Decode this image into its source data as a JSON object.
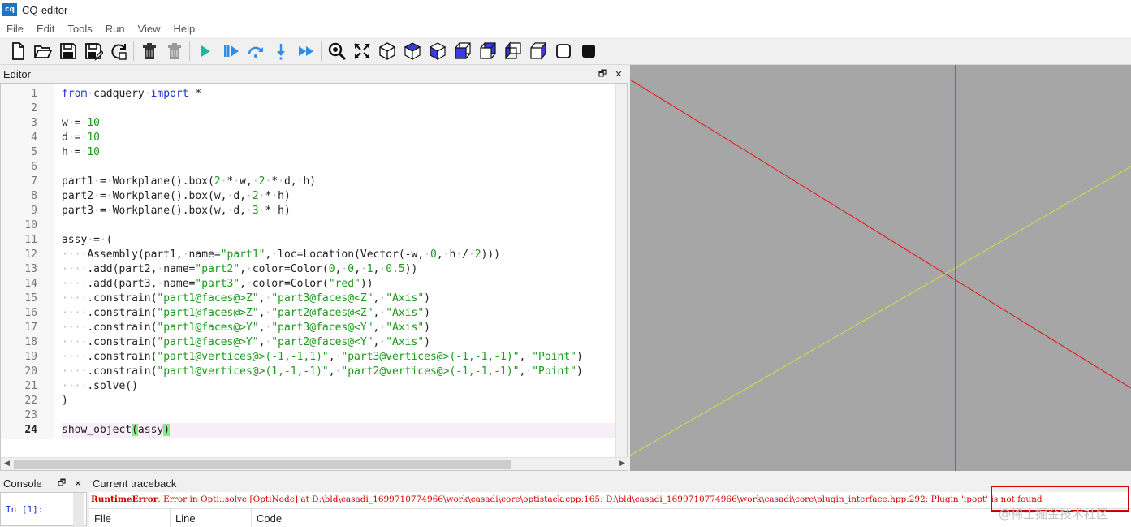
{
  "app": {
    "icon_text": "cq",
    "title": "CQ-editor"
  },
  "menu": [
    "File",
    "Edit",
    "Tools",
    "Run",
    "View",
    "Help"
  ],
  "toolbar": {
    "icons": [
      "new-file-icon",
      "open-file-icon",
      "save-icon",
      "save-as-icon",
      "reload-icon",
      "clear-icon",
      "delete-icon",
      "run-icon",
      "debug-icon",
      "step-over-icon",
      "step-into-icon",
      "continue-icon",
      "zoom-icon",
      "fit-icon",
      "iso-view-icon",
      "top-view-icon",
      "bottom-view-icon",
      "front-view-icon",
      "back-view-icon",
      "left-view-icon",
      "right-view-icon",
      "wireframe-icon",
      "shaded-icon"
    ]
  },
  "editor": {
    "title": "Editor",
    "float_label": "🗗",
    "close_label": "✕",
    "current_line": 24,
    "line_numbers": [
      "1",
      "2",
      "3",
      "4",
      "5",
      "6",
      "7",
      "8",
      "9",
      "10",
      "11",
      "12",
      "13",
      "14",
      "15",
      "16",
      "17",
      "18",
      "19",
      "20",
      "21",
      "22",
      "23",
      "24"
    ]
  },
  "console": {
    "title": "Console",
    "prompt": "In [1]:"
  },
  "traceback": {
    "title": "Current traceback",
    "error_type": "RuntimeError",
    "error_message": ": Error in Opti::solve [OptiNode] at D:\\bld\\casadi_1699710774966\\work\\casadi\\core\\optistack.cpp:165: D:\\bld\\casadi_1699710774966\\work\\casadi\\core\\plugin_interface.hpp:292: Plugin 'ipopt' is not found",
    "columns": [
      "File",
      "Line",
      "Code"
    ]
  },
  "watermark": "@稀土掘金技术社区",
  "colors": {
    "viewer_bg": "#a6a6a6",
    "axis_x": "#e81010",
    "axis_y": "#d4e040",
    "axis_z": "#4848f0",
    "keyword": "#1a2fd0",
    "string": "#1a9a1a",
    "error": "#d10000"
  }
}
